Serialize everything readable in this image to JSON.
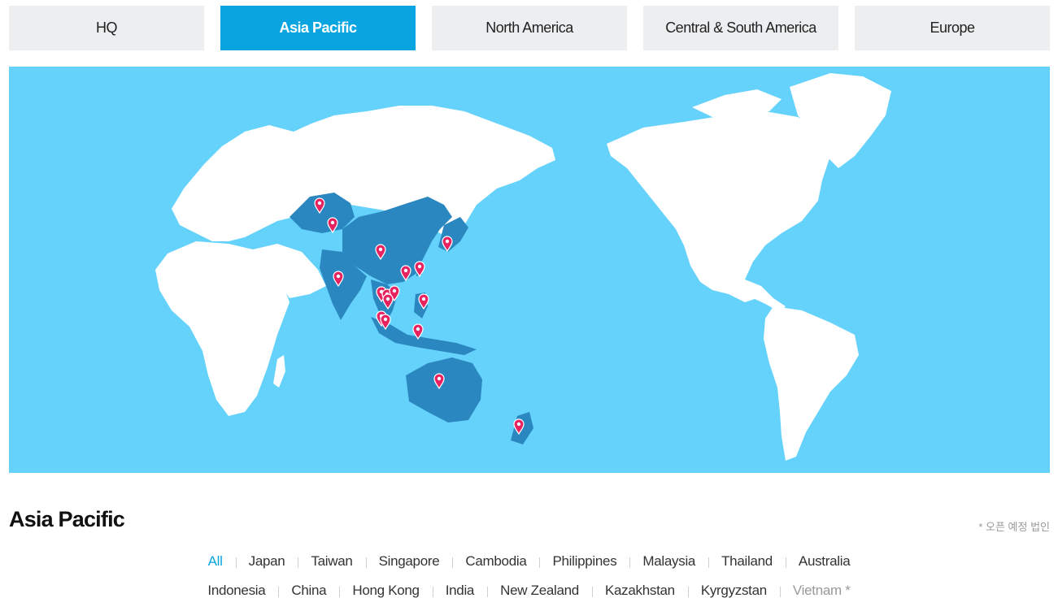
{
  "tabs": [
    {
      "label": "HQ",
      "active": false
    },
    {
      "label": "Asia Pacific",
      "active": true
    },
    {
      "label": "North America",
      "active": false
    },
    {
      "label": "Central & South America",
      "active": false
    },
    {
      "label": "Europe",
      "active": false
    }
  ],
  "map": {
    "ocean_color": "#64d2fa",
    "land_color": "#ffffff",
    "highlight_color": "#2b87c0",
    "marker_color": "#e8215f",
    "marker_icon": "location-pin-icon"
  },
  "section": {
    "title": "Asia Pacific",
    "note": "* 오픈 예정 법인"
  },
  "filters": {
    "row1": [
      {
        "label": "All",
        "active": true
      },
      {
        "label": "Japan"
      },
      {
        "label": "Taiwan"
      },
      {
        "label": "Singapore"
      },
      {
        "label": "Cambodia"
      },
      {
        "label": "Philippines"
      },
      {
        "label": "Malaysia"
      },
      {
        "label": "Thailand"
      },
      {
        "label": "Australia"
      }
    ],
    "row2": [
      {
        "label": "Indonesia"
      },
      {
        "label": "China"
      },
      {
        "label": "Hong Kong"
      },
      {
        "label": "India"
      },
      {
        "label": "New Zealand"
      },
      {
        "label": "Kazakhstan"
      },
      {
        "label": "Kyrgyzstan"
      },
      {
        "label": "Vietnam *",
        "pending": true
      }
    ]
  }
}
